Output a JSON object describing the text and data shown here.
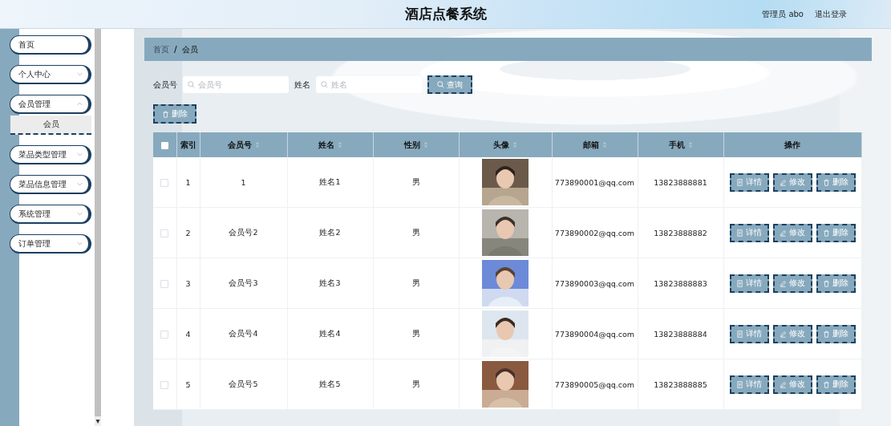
{
  "header": {
    "title": "酒店点餐系统",
    "user": "管理员 abo",
    "logout": "退出登录"
  },
  "sidebar": {
    "items": [
      {
        "label": "首页",
        "kind": "link"
      },
      {
        "label": "个人中心",
        "kind": "menu",
        "expanded": false
      },
      {
        "label": "会员管理",
        "kind": "menu",
        "expanded": true,
        "children": [
          {
            "label": "会员",
            "selected": true
          }
        ]
      },
      {
        "label": "菜品类型管理",
        "kind": "menu",
        "expanded": false
      },
      {
        "label": "菜品信息管理",
        "kind": "menu",
        "expanded": false
      },
      {
        "label": "系统管理",
        "kind": "menu",
        "expanded": false
      },
      {
        "label": "订单管理",
        "kind": "menu",
        "expanded": false
      }
    ]
  },
  "breadcrumb": {
    "items": [
      "首页",
      "会员"
    ],
    "separator": "/"
  },
  "scrollbar_arrow": "▾",
  "search": {
    "fields": [
      {
        "label": "会员号",
        "placeholder": "会员号"
      },
      {
        "label": "姓名",
        "placeholder": "姓名"
      }
    ],
    "button": "查询"
  },
  "bulk_delete": "删除",
  "table": {
    "columns": [
      {
        "label": "索引",
        "sortable": false
      },
      {
        "label": "会员号",
        "sortable": true
      },
      {
        "label": "姓名",
        "sortable": true
      },
      {
        "label": "性别",
        "sortable": true
      },
      {
        "label": "头像",
        "sortable": true
      },
      {
        "label": "邮箱",
        "sortable": true
      },
      {
        "label": "手机",
        "sortable": true
      },
      {
        "label": "操作",
        "sortable": false
      }
    ],
    "header_checked": false,
    "rows": [
      {
        "checked": false,
        "index": "1",
        "member_no": "1",
        "name": "姓名1",
        "gender": "男",
        "email": "773890001@qq.com",
        "phone": "13823888881",
        "actions": [
          "详情",
          "修改",
          "删除"
        ]
      },
      {
        "checked": false,
        "index": "2",
        "member_no": "会员号2",
        "name": "姓名2",
        "gender": "男",
        "email": "773890002@qq.com",
        "phone": "13823888882",
        "actions": [
          "详情",
          "修改",
          "删除"
        ]
      },
      {
        "checked": false,
        "index": "3",
        "member_no": "会员号3",
        "name": "姓名3",
        "gender": "男",
        "email": "773890003@qq.com",
        "phone": "13823888883",
        "actions": [
          "详情",
          "修改",
          "删除"
        ]
      },
      {
        "checked": false,
        "index": "4",
        "member_no": "会员号4",
        "name": "姓名4",
        "gender": "男",
        "email": "773890004@qq.com",
        "phone": "13823888884",
        "actions": [
          "详情",
          "修改",
          "删除"
        ]
      },
      {
        "checked": false,
        "index": "5",
        "member_no": "会员号5",
        "name": "姓名5",
        "gender": "男",
        "email": "773890005@qq.com",
        "phone": "13823888885",
        "actions": [
          "详情",
          "修改",
          "删除"
        ]
      }
    ]
  }
}
